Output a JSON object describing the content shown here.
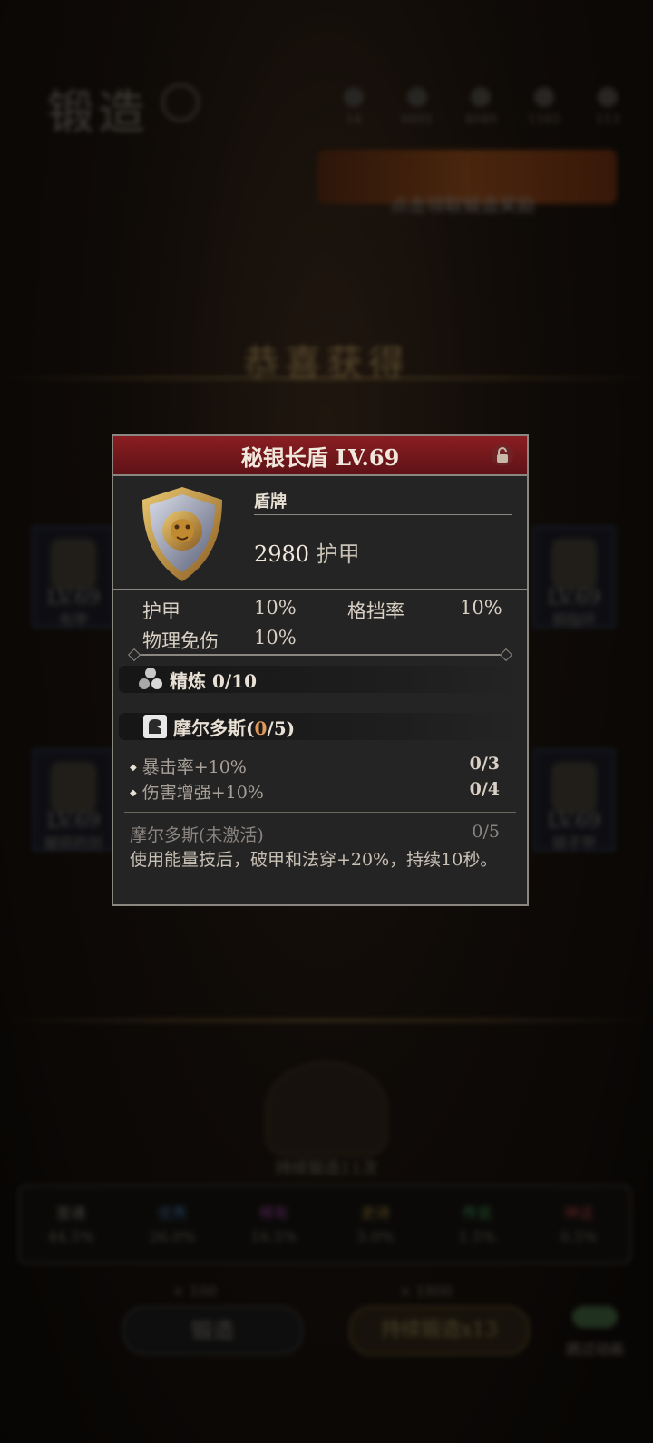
{
  "background": {
    "screen_title": "锻造",
    "resources": [
      "14",
      "6691",
      "4049",
      "1165",
      "113"
    ],
    "banner_text": "点击领取锻造奖励",
    "congrats_text": "恭喜获得",
    "left_slots": [
      {
        "level": "LV.69",
        "name": "布甲"
      },
      {
        "level": "LV.69",
        "name": "破损的剑"
      }
    ],
    "right_slots": [
      {
        "level": "LV.69",
        "name": "铜指环"
      },
      {
        "level": "LV.69",
        "name": "锁子甲"
      }
    ],
    "forge_count": "持续锻造11次",
    "rarities": [
      {
        "name": "普通",
        "pct": "44.5%",
        "color": "#7a746c"
      },
      {
        "name": "优秀",
        "pct": "26.0%",
        "color": "#3a6a9a"
      },
      {
        "name": "稀有",
        "pct": "16.5%",
        "color": "#8a3a8a"
      },
      {
        "name": "史诗",
        "pct": "5.0%",
        "color": "#9a7a3a"
      },
      {
        "name": "传说",
        "pct": "1.5%",
        "color": "#3a8a4a"
      },
      {
        "name": "神话",
        "pct": "0.5%",
        "color": "#9a3a3a"
      }
    ],
    "forge_cost": "× 100",
    "forge_button": "锻造",
    "continuous_cost": "× 1800",
    "continuous_button": "持续锻造x13",
    "skip_label": "跳过动画"
  },
  "item": {
    "title": "秘银长盾 LV.69",
    "type": "盾牌",
    "main_value": "2980",
    "main_unit": "护甲",
    "stats": [
      {
        "label": "护甲",
        "value": "10%"
      },
      {
        "label": "格挡率",
        "value": "10%"
      },
      {
        "label": "物理免伤",
        "value": "10%"
      }
    ],
    "refine_label": "精炼 0/10",
    "set_name": "摩尔多斯(",
    "set_count_current": "0",
    "set_count_suffix": "/5)",
    "set_bonuses": [
      {
        "label": "暴击率+10%",
        "value": "0/3"
      },
      {
        "label": "伤害增强+10%",
        "value": "0/4"
      }
    ],
    "set_effect_title": "摩尔多斯(未激活)",
    "set_effect_progress": "0/5",
    "set_effect_desc": "使用能量技后，破甲和法穿+20%，持续10秒。"
  },
  "colors": {
    "header_red": "#8a1e22",
    "highlight_orange": "#e09a5a",
    "panel_bg": "#252424"
  },
  "icons": [
    "shield-icon",
    "lock-icon",
    "refine-icon",
    "set-icon",
    "clock-icon"
  ]
}
